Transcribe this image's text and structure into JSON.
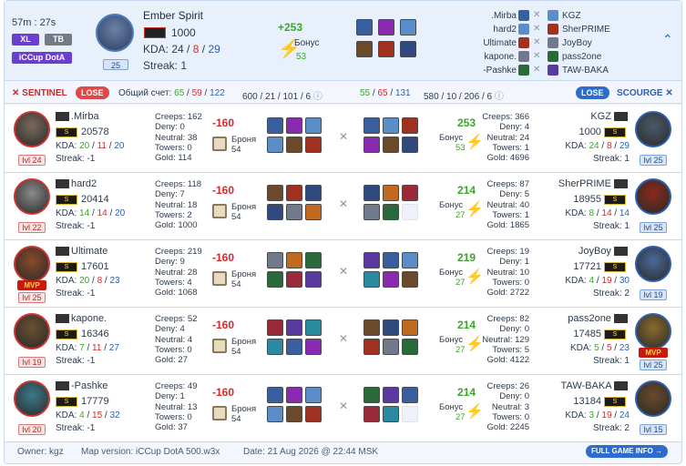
{
  "header": {
    "duration": "57m : 27s",
    "badges": [
      "XL",
      "TB",
      "iCCup DotA"
    ],
    "hero_name": "Ember Spirit",
    "hero_level": "25",
    "rank": "1000",
    "kda_label": "KDA:",
    "kda_k": "24",
    "kda_d": "8",
    "kda_a": "29",
    "streak": "Streak: 1",
    "bonus_points": "+253",
    "bonus_label": "Бонус",
    "bonus_value": "53",
    "sentinel_list": [
      ".Mirba",
      "hard2",
      "Ultimate",
      "kapone.",
      "-Pashke"
    ],
    "scourge_list": [
      "KGZ",
      "SherPRIME",
      "JoyBoy",
      "pass2one",
      "TAW-BAKA"
    ]
  },
  "teams": {
    "sentinel_label": "SENTINEL",
    "sentinel_result": "LOSE",
    "total_label": "Общий счет:",
    "s_k": "65",
    "s_d": "59",
    "s_a": "122",
    "s_creeps": "600",
    "s_deny": "21",
    "s_neutral": "101",
    "s_towers": "6",
    "c_k": "55",
    "c_d": "65",
    "c_a": "131",
    "c_creeps": "580",
    "c_deny": "10",
    "c_neutral": "206",
    "c_towers": "6",
    "scourge_result": "LOSE",
    "scourge_label": "SCOURGE"
  },
  "sentinel": [
    {
      "name": ".Mirba",
      "rating": "20578",
      "k": "20",
      "d": "11",
      "a": "20",
      "streak": "Streak: -1",
      "lvl": "lvl 24",
      "creeps": "Creeps: 162",
      "deny": "Deny: 0",
      "neutral": "Neutral: 38",
      "towers": "Towers: 0",
      "gold": "Gold: 114",
      "penalty": "-160",
      "armor": "Броня",
      "armor_val": "54",
      "mvp": ""
    },
    {
      "name": "hard2",
      "rating": "20414",
      "k": "14",
      "d": "14",
      "a": "20",
      "streak": "Streak: -1",
      "lvl": "lvl 22",
      "creeps": "Creeps: 118",
      "deny": "Deny: 7",
      "neutral": "Neutral: 18",
      "towers": "Towers: 2",
      "gold": "Gold: 1000",
      "penalty": "-160",
      "armor": "Броня",
      "armor_val": "54",
      "mvp": ""
    },
    {
      "name": "Ultimate",
      "rating": "17601",
      "k": "20",
      "d": "8",
      "a": "23",
      "streak": "Streak: -1",
      "lvl": "lvl 25",
      "creeps": "Creeps: 219",
      "deny": "Deny: 9",
      "neutral": "Neutral: 28",
      "towers": "Towers: 4",
      "gold": "Gold: 1068",
      "penalty": "-160",
      "armor": "Броня",
      "armor_val": "54",
      "mvp": "MVP"
    },
    {
      "name": "kapone.",
      "rating": "16346",
      "k": "7",
      "d": "11",
      "a": "27",
      "streak": "Streak: -1",
      "lvl": "lvl 19",
      "creeps": "Creeps: 52",
      "deny": "Deny: 4",
      "neutral": "Neutral: 4",
      "towers": "Towers: 0",
      "gold": "Gold: 27",
      "penalty": "-160",
      "armor": "Броня",
      "armor_val": "54",
      "mvp": ""
    },
    {
      "name": "-Pashke",
      "rating": "17779",
      "k": "4",
      "d": "15",
      "a": "32",
      "streak": "Streak: -1",
      "lvl": "lvl 20",
      "creeps": "Creeps: 49",
      "deny": "Deny: 1",
      "neutral": "Neutral: 13",
      "towers": "Towers: 0",
      "gold": "Gold: 37",
      "penalty": "-160",
      "armor": "Броня",
      "armor_val": "54",
      "mvp": ""
    }
  ],
  "scourge": [
    {
      "name": "KGZ",
      "rating": "1000",
      "k": "24",
      "d": "8",
      "a": "29",
      "streak": "Streak: 1",
      "lvl": "lvl 25",
      "creeps": "Creeps: 366",
      "deny": "Deny: 4",
      "neutral": "Neutral: 24",
      "towers": "Towers: 1",
      "gold": "Gold: 4696",
      "gain": "253",
      "bonus": "Бонус",
      "bonus_val": "53",
      "mvp": ""
    },
    {
      "name": "SherPRIME",
      "rating": "18955",
      "k": "8",
      "d": "14",
      "a": "14",
      "streak": "Streak: 1",
      "lvl": "lvl 25",
      "creeps": "Creeps: 87",
      "deny": "Deny: 5",
      "neutral": "Neutral: 40",
      "towers": "Towers: 1",
      "gold": "Gold: 1865",
      "gain": "214",
      "bonus": "Бонус",
      "bonus_val": "27",
      "mvp": ""
    },
    {
      "name": "JoyBoy",
      "rating": "17721",
      "k": "4",
      "d": "19",
      "a": "30",
      "streak": "Streak: 2",
      "lvl": "lvl 19",
      "creeps": "Creeps: 19",
      "deny": "Deny: 1",
      "neutral": "Neutral: 10",
      "towers": "Towers: 0",
      "gold": "Gold: 2722",
      "gain": "219",
      "bonus": "Бонус",
      "bonus_val": "27",
      "mvp": ""
    },
    {
      "name": "pass2one",
      "rating": "17485",
      "k": "5",
      "d": "5",
      "a": "23",
      "streak": "Streak: 1",
      "lvl": "lvl 25",
      "creeps": "Creeps: 82",
      "deny": "Deny: 0",
      "neutral": "Neutral: 129",
      "towers": "Towers: 5",
      "gold": "Gold: 4122",
      "gain": "214",
      "bonus": "Бонус",
      "bonus_val": "27",
      "mvp": "MVP"
    },
    {
      "name": "TAW-BAKA",
      "rating": "13184",
      "k": "3",
      "d": "19",
      "a": "24",
      "streak": "Streak: 2",
      "lvl": "lvl 15",
      "creeps": "Creeps: 26",
      "deny": "Deny: 0",
      "neutral": "Neutral: 3",
      "towers": "Towers: 0",
      "gold": "Gold: 2245",
      "gain": "214",
      "bonus": "Бонус",
      "bonus_val": "27",
      "mvp": ""
    }
  ],
  "footer": {
    "owner": "Owner: kgz",
    "map": "Map version: iCCup DotA 500.w3x",
    "date": "Date: 21 Aug 2026 @ 22:44 MSK",
    "full_info": "FULL GAME INFO →"
  },
  "colors": {
    "sentinel": "#c12e2e",
    "scourge": "#2d5fb0",
    "win": "#3ca42c",
    "lose": "#d62a2a",
    "accent": "#6a3fd0"
  }
}
